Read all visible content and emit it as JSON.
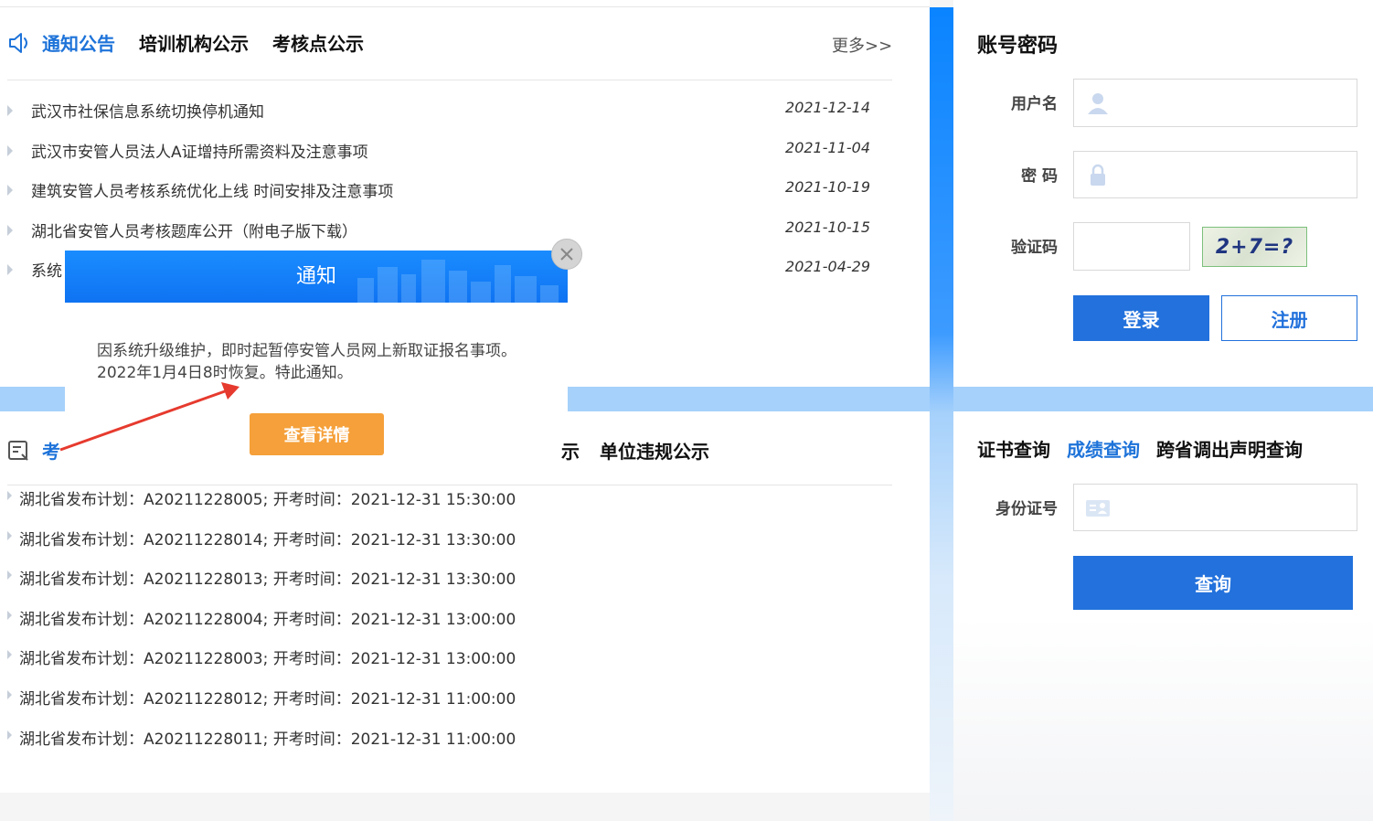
{
  "notice_section": {
    "tabs": [
      "通知公告",
      "培训机构公示",
      "考核点公示"
    ],
    "more": "更多>>",
    "items": [
      {
        "title": "武汉市社保信息系统切换停机通知",
        "date": "2021-12-14"
      },
      {
        "title": "武汉市安管人员法人A证增持所需资料及注意事项",
        "date": "2021-11-04"
      },
      {
        "title": "建筑安管人员考核系统优化上线 时间安排及注意事项",
        "date": "2021-10-19"
      },
      {
        "title": "湖北省安管人员考核题库公开（附电子版下载）",
        "date": "2021-10-15"
      },
      {
        "title": "系统",
        "date": "2021-04-29"
      }
    ]
  },
  "exam_section": {
    "tab_visible": "考",
    "tab_right_fragment": "示",
    "tab_violations": "单位违规公示",
    "items": [
      "湖北省发布计划：A20211228005; 开考时间：2021-12-31 15:30:00",
      "湖北省发布计划：A20211228014; 开考时间：2021-12-31 13:30:00",
      "湖北省发布计划：A20211228013; 开考时间：2021-12-31 13:30:00",
      "湖北省发布计划：A20211228004; 开考时间：2021-12-31 13:00:00",
      "湖北省发布计划：A20211228003; 开考时间：2021-12-31 13:00:00",
      "湖北省发布计划：A20211228012; 开考时间：2021-12-31 11:00:00",
      "湖北省发布计划：A20211228011; 开考时间：2021-12-31 11:00:00"
    ]
  },
  "login": {
    "title": "账号密码",
    "username_label": "用户名",
    "password_label": "密 码",
    "captcha_label": "验证码",
    "captcha_text": "2+7=?",
    "login_button": "登录",
    "register_button": "注册"
  },
  "query": {
    "tabs": [
      "证书查询",
      "成绩查询",
      "跨省调出声明查询"
    ],
    "id_label": "身份证号",
    "query_button": "查询"
  },
  "modal": {
    "title": "通知",
    "body": "因系统升级维护，即时起暂停安管人员网上新取证报名事项。2022年1月4日8时恢复。特此通知。",
    "details_button": "查看详情"
  },
  "colors": {
    "brand_blue": "#2271dc",
    "accent_orange": "#f5a03a",
    "band_blue": "#a6d1fb"
  }
}
